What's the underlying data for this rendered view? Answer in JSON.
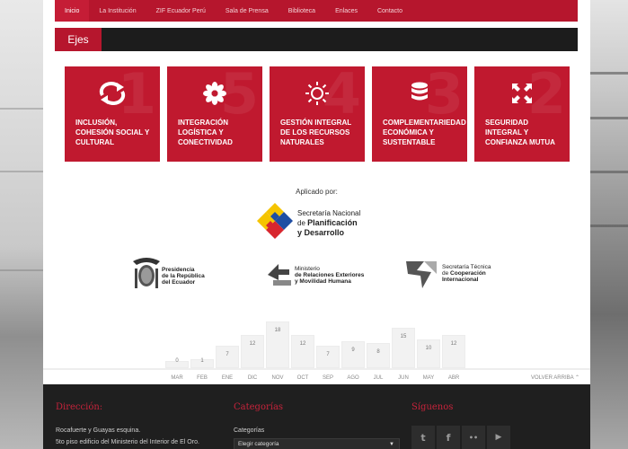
{
  "nav": {
    "items": [
      "Inicio",
      "La Institución",
      "ZIF Ecuador Perú",
      "Sala de Prensa",
      "Biblioteca",
      "Enlaces",
      "Contacto"
    ]
  },
  "section": {
    "title": "Ejes"
  },
  "tiles": [
    {
      "label": "INCLUSIÓN, COHESIÓN SOCIAL Y CULTURAL",
      "number": "1",
      "icon": "refresh-arrows-icon"
    },
    {
      "label": "INTEGRACIÓN LOGÍSTICA Y CONECTIVIDAD",
      "number": "5",
      "icon": "flower-icon"
    },
    {
      "label": "GESTIÓN INTEGRAL DE LOS RECURSOS NATURALES",
      "number": "4",
      "icon": "sun-icon"
    },
    {
      "label": "COMPLEMENTARIEDAD ECONÓMICA Y SUSTENTABLE",
      "number": "3",
      "icon": "database-stack-icon"
    },
    {
      "label": "SEGURIDAD INTEGRAL Y CONFIANZA MUTUA",
      "number": "2",
      "icon": "shrink-arrows-icon"
    }
  ],
  "sponsors": {
    "applied_by": "Aplicado por:",
    "senplades": {
      "line1": "Secretaría Nacional",
      "line2": "de",
      "line3": "Planificación",
      "line4": "y Desarrollo"
    },
    "presidencia": {
      "line1": "Presidencia",
      "line2": "de la República",
      "line3": "del Ecuador"
    },
    "cancilleria": {
      "line1": "Ministerio",
      "line2": "de Relaciones Exteriores",
      "line3": "y Movilidad Humana"
    },
    "cooperacion": {
      "line1": "Secretaría Técnica",
      "line2": "de",
      "line3": "Cooperación",
      "line4": "Internacional"
    }
  },
  "chart_data": {
    "type": "bar",
    "categories": [
      "MAR",
      "FEB",
      "ENE",
      "DIC",
      "NOV",
      "OCT",
      "SEP",
      "AGO",
      "JUL",
      "JUN",
      "MAY",
      "ABR"
    ],
    "values": [
      0,
      1,
      7,
      12,
      18,
      12,
      7,
      9,
      8,
      15,
      10,
      12
    ],
    "ylim": [
      0,
      18
    ]
  },
  "archive": {
    "back_to_top": "VOLVER ARRIBA"
  },
  "footer": {
    "direccion_title": "Dirección:",
    "direccion_line1": "Rocafuerte y Guayas esquina.",
    "direccion_line2": "5to piso edificio del Ministerio del Interior de El Oro.",
    "categorias_title": "Categorías",
    "categorias_label": "Categorías",
    "categorias_select": "Elegir categoría",
    "siguenos_title": "Síguenos",
    "social": [
      {
        "icon": "twitter-icon",
        "glyph": "t"
      },
      {
        "icon": "facebook-icon",
        "glyph": "f"
      },
      {
        "icon": "flickr-icon",
        "glyph": "••"
      },
      {
        "icon": "youtube-icon",
        "glyph": "▶"
      }
    ]
  }
}
